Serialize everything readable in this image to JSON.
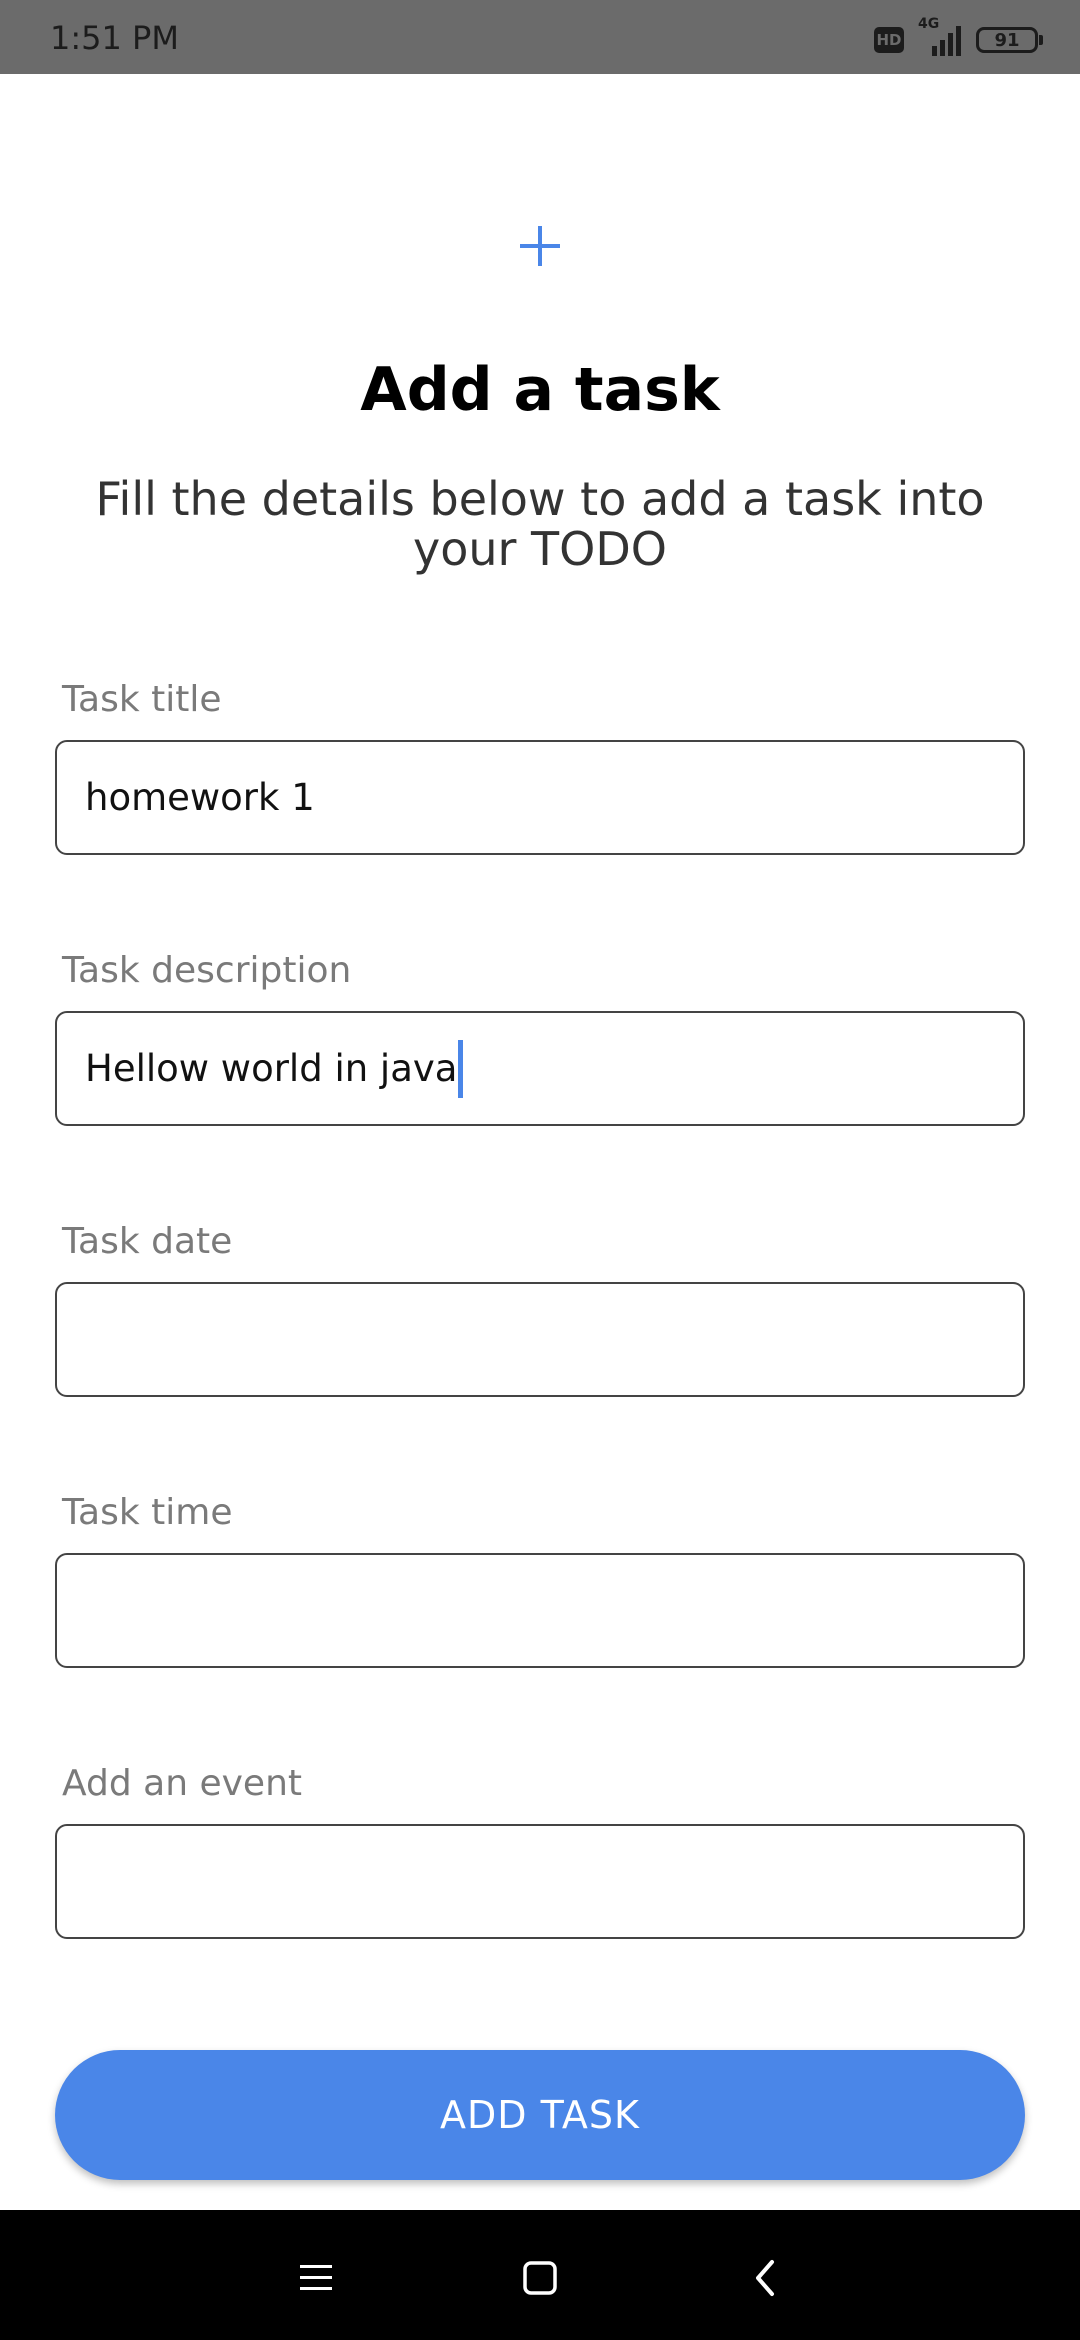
{
  "status_bar": {
    "time": "1:51 PM",
    "hd": "HD",
    "network": "4G",
    "battery": "91",
    "icons": [
      "hd-icon",
      "signal-icon",
      "battery-icon"
    ]
  },
  "header": {
    "icon": "plus-icon",
    "title": "Add a task",
    "subtitle": "Fill the details below to add a task into your TODO"
  },
  "form": {
    "task_title": {
      "label": "Task title",
      "value": "homework 1"
    },
    "task_description": {
      "label": "Task description",
      "value": "Hellow world in java"
    },
    "task_date": {
      "label": "Task date",
      "value": ""
    },
    "task_time": {
      "label": "Task time",
      "value": ""
    },
    "add_event": {
      "label": "Add an event",
      "value": ""
    }
  },
  "submit": {
    "label": "ADD TASK"
  },
  "navigation": {
    "icons": [
      "menu-icon",
      "home-icon",
      "back-icon"
    ]
  },
  "colors": {
    "accent": "#4a86e8",
    "status_bar": "#6b6b6b",
    "nav_bar": "#000000"
  }
}
